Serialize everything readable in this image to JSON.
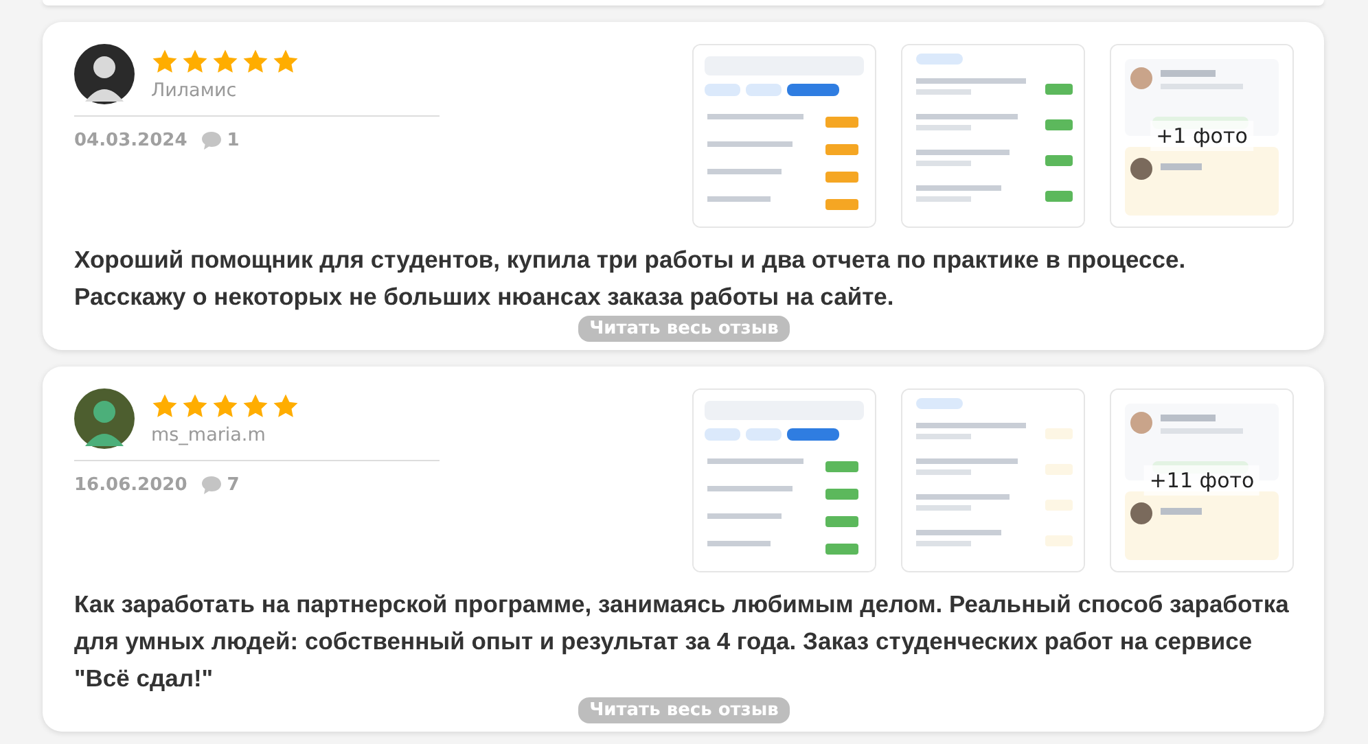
{
  "reviews": [
    {
      "author": "Лиламис",
      "stars": 5,
      "date": "04.03.2024",
      "comments": "1",
      "avatar": {
        "kind": "picture"
      },
      "photos": [
        {
          "kind": "picture"
        },
        {
          "kind": "picture"
        },
        {
          "kind": "picture",
          "more": "+1 фото"
        }
      ],
      "text": "Хороший помощник для студентов, купила три работы и два отчета по практике в процессе. Расскажу о некоторых не больших нюансах заказа работы на сайте.",
      "read_more": "Читать весь отзыв"
    },
    {
      "author": "ms_maria.m",
      "stars": 5,
      "date": "16.06.2020",
      "comments": "7",
      "avatar": {
        "kind": "picture"
      },
      "photos": [
        {
          "kind": "picture"
        },
        {
          "kind": "picture"
        },
        {
          "kind": "picture",
          "more": "+11 фото"
        }
      ],
      "text": "Как заработать на партнерской программе, занимаясь любимым делом. Реальный способ заработка для умных людей: собственный опыт и результат за 4 года. Заказ студенческих работ на сервисе \"Всё сдал!\"",
      "read_more": "Читать весь отзыв"
    }
  ]
}
